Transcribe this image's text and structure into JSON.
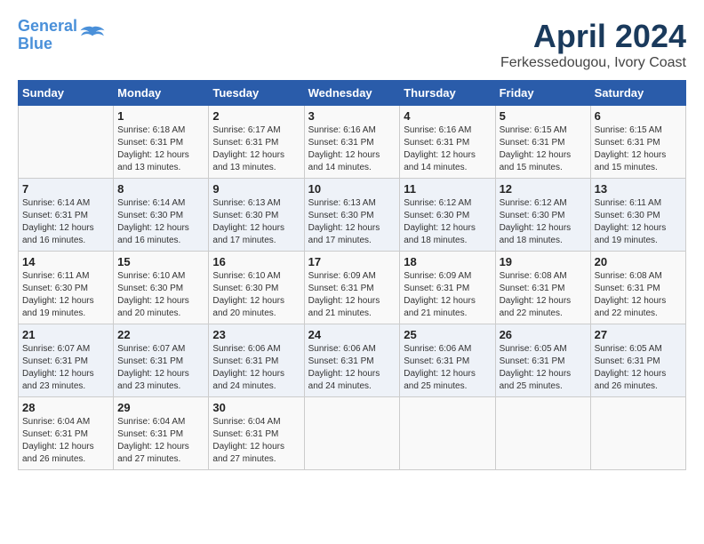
{
  "header": {
    "logo_line1": "General",
    "logo_line2": "Blue",
    "month_title": "April 2024",
    "subtitle": "Ferkessedougou, Ivory Coast"
  },
  "days_of_week": [
    "Sunday",
    "Monday",
    "Tuesday",
    "Wednesday",
    "Thursday",
    "Friday",
    "Saturday"
  ],
  "weeks": [
    [
      {
        "num": "",
        "sunrise": "",
        "sunset": "",
        "daylight": ""
      },
      {
        "num": "1",
        "sunrise": "6:18 AM",
        "sunset": "6:31 PM",
        "daylight": "12 hours and 13 minutes."
      },
      {
        "num": "2",
        "sunrise": "6:17 AM",
        "sunset": "6:31 PM",
        "daylight": "12 hours and 13 minutes."
      },
      {
        "num": "3",
        "sunrise": "6:16 AM",
        "sunset": "6:31 PM",
        "daylight": "12 hours and 14 minutes."
      },
      {
        "num": "4",
        "sunrise": "6:16 AM",
        "sunset": "6:31 PM",
        "daylight": "12 hours and 14 minutes."
      },
      {
        "num": "5",
        "sunrise": "6:15 AM",
        "sunset": "6:31 PM",
        "daylight": "12 hours and 15 minutes."
      },
      {
        "num": "6",
        "sunrise": "6:15 AM",
        "sunset": "6:31 PM",
        "daylight": "12 hours and 15 minutes."
      }
    ],
    [
      {
        "num": "7",
        "sunrise": "6:14 AM",
        "sunset": "6:31 PM",
        "daylight": "12 hours and 16 minutes."
      },
      {
        "num": "8",
        "sunrise": "6:14 AM",
        "sunset": "6:30 PM",
        "daylight": "12 hours and 16 minutes."
      },
      {
        "num": "9",
        "sunrise": "6:13 AM",
        "sunset": "6:30 PM",
        "daylight": "12 hours and 17 minutes."
      },
      {
        "num": "10",
        "sunrise": "6:13 AM",
        "sunset": "6:30 PM",
        "daylight": "12 hours and 17 minutes."
      },
      {
        "num": "11",
        "sunrise": "6:12 AM",
        "sunset": "6:30 PM",
        "daylight": "12 hours and 18 minutes."
      },
      {
        "num": "12",
        "sunrise": "6:12 AM",
        "sunset": "6:30 PM",
        "daylight": "12 hours and 18 minutes."
      },
      {
        "num": "13",
        "sunrise": "6:11 AM",
        "sunset": "6:30 PM",
        "daylight": "12 hours and 19 minutes."
      }
    ],
    [
      {
        "num": "14",
        "sunrise": "6:11 AM",
        "sunset": "6:30 PM",
        "daylight": "12 hours and 19 minutes."
      },
      {
        "num": "15",
        "sunrise": "6:10 AM",
        "sunset": "6:30 PM",
        "daylight": "12 hours and 20 minutes."
      },
      {
        "num": "16",
        "sunrise": "6:10 AM",
        "sunset": "6:30 PM",
        "daylight": "12 hours and 20 minutes."
      },
      {
        "num": "17",
        "sunrise": "6:09 AM",
        "sunset": "6:31 PM",
        "daylight": "12 hours and 21 minutes."
      },
      {
        "num": "18",
        "sunrise": "6:09 AM",
        "sunset": "6:31 PM",
        "daylight": "12 hours and 21 minutes."
      },
      {
        "num": "19",
        "sunrise": "6:08 AM",
        "sunset": "6:31 PM",
        "daylight": "12 hours and 22 minutes."
      },
      {
        "num": "20",
        "sunrise": "6:08 AM",
        "sunset": "6:31 PM",
        "daylight": "12 hours and 22 minutes."
      }
    ],
    [
      {
        "num": "21",
        "sunrise": "6:07 AM",
        "sunset": "6:31 PM",
        "daylight": "12 hours and 23 minutes."
      },
      {
        "num": "22",
        "sunrise": "6:07 AM",
        "sunset": "6:31 PM",
        "daylight": "12 hours and 23 minutes."
      },
      {
        "num": "23",
        "sunrise": "6:06 AM",
        "sunset": "6:31 PM",
        "daylight": "12 hours and 24 minutes."
      },
      {
        "num": "24",
        "sunrise": "6:06 AM",
        "sunset": "6:31 PM",
        "daylight": "12 hours and 24 minutes."
      },
      {
        "num": "25",
        "sunrise": "6:06 AM",
        "sunset": "6:31 PM",
        "daylight": "12 hours and 25 minutes."
      },
      {
        "num": "26",
        "sunrise": "6:05 AM",
        "sunset": "6:31 PM",
        "daylight": "12 hours and 25 minutes."
      },
      {
        "num": "27",
        "sunrise": "6:05 AM",
        "sunset": "6:31 PM",
        "daylight": "12 hours and 26 minutes."
      }
    ],
    [
      {
        "num": "28",
        "sunrise": "6:04 AM",
        "sunset": "6:31 PM",
        "daylight": "12 hours and 26 minutes."
      },
      {
        "num": "29",
        "sunrise": "6:04 AM",
        "sunset": "6:31 PM",
        "daylight": "12 hours and 27 minutes."
      },
      {
        "num": "30",
        "sunrise": "6:04 AM",
        "sunset": "6:31 PM",
        "daylight": "12 hours and 27 minutes."
      },
      {
        "num": "",
        "sunrise": "",
        "sunset": "",
        "daylight": ""
      },
      {
        "num": "",
        "sunrise": "",
        "sunset": "",
        "daylight": ""
      },
      {
        "num": "",
        "sunrise": "",
        "sunset": "",
        "daylight": ""
      },
      {
        "num": "",
        "sunrise": "",
        "sunset": "",
        "daylight": ""
      }
    ]
  ]
}
